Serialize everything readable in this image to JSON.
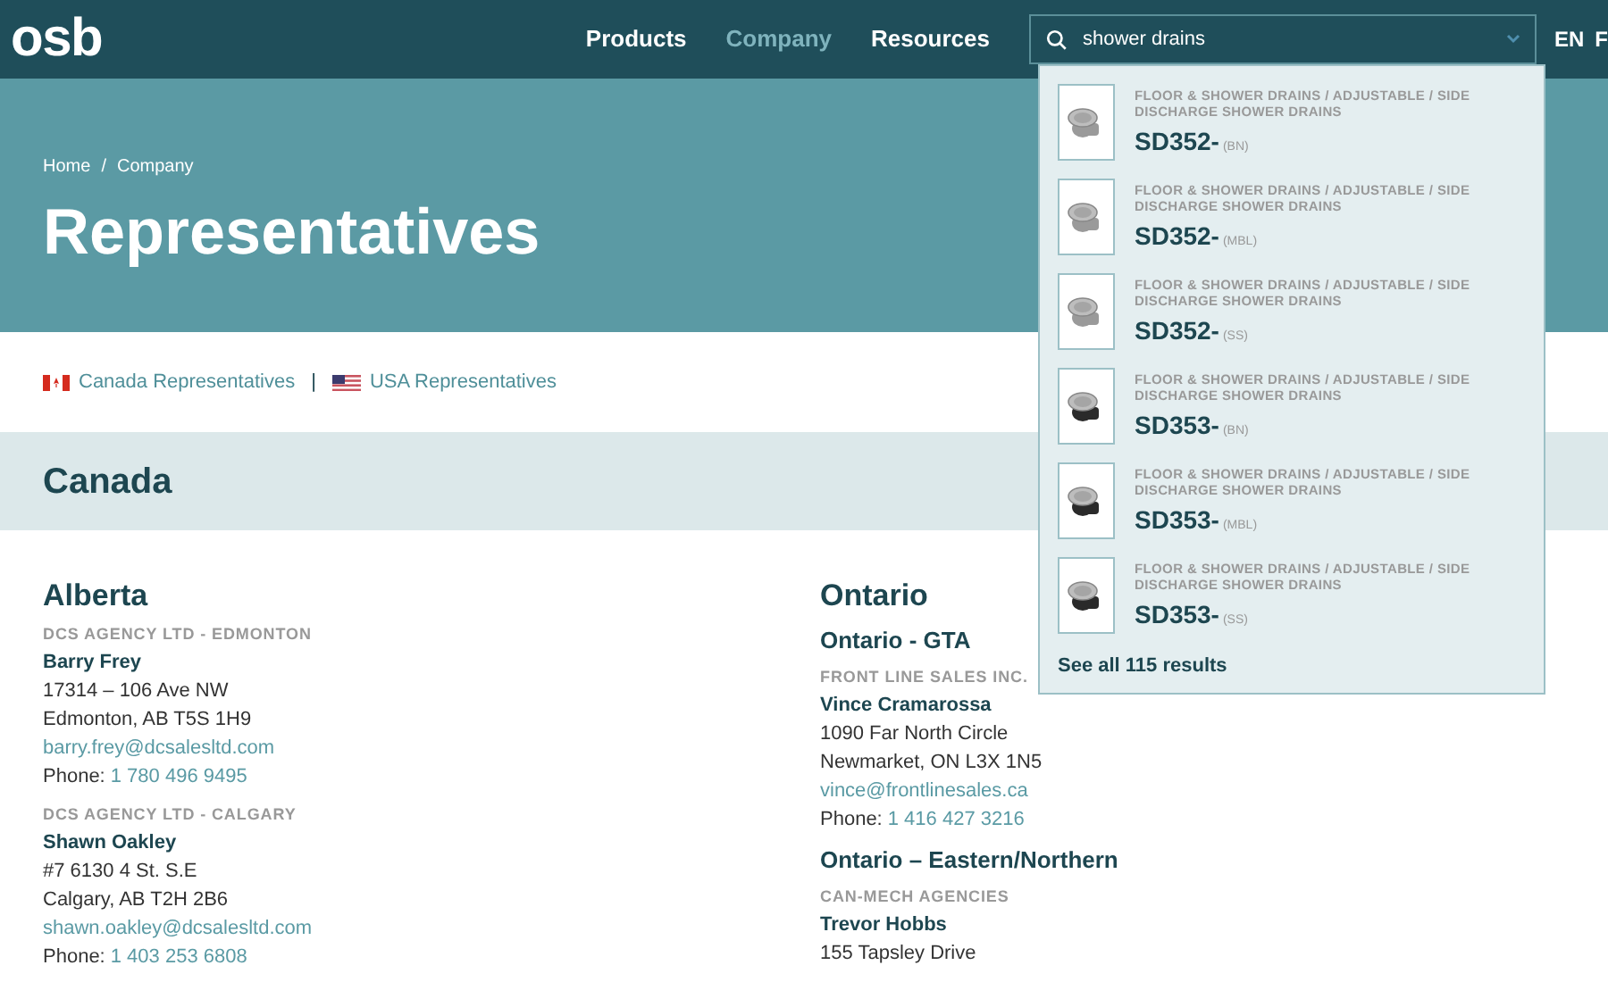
{
  "header": {
    "logo": "osb",
    "nav": [
      {
        "label": "Products",
        "selected": false
      },
      {
        "label": "Company",
        "selected": true
      },
      {
        "label": "Resources",
        "selected": false
      }
    ],
    "search": {
      "value": "shower drains"
    },
    "languages": [
      "EN",
      "F"
    ]
  },
  "search_results": {
    "items": [
      {
        "category": "FLOOR & SHOWER DRAINS / ADJUSTABLE / SIDE DISCHARGE SHOWER DRAINS",
        "code": "SD352-",
        "variant": "(BN)",
        "kind": "grey"
      },
      {
        "category": "FLOOR & SHOWER DRAINS / ADJUSTABLE / SIDE DISCHARGE SHOWER DRAINS",
        "code": "SD352-",
        "variant": "(MBL)",
        "kind": "grey"
      },
      {
        "category": "FLOOR & SHOWER DRAINS / ADJUSTABLE / SIDE DISCHARGE SHOWER DRAINS",
        "code": "SD352-",
        "variant": "(SS)",
        "kind": "grey"
      },
      {
        "category": "FLOOR & SHOWER DRAINS / ADJUSTABLE / SIDE DISCHARGE SHOWER DRAINS",
        "code": "SD353-",
        "variant": "(BN)",
        "kind": "black"
      },
      {
        "category": "FLOOR & SHOWER DRAINS / ADJUSTABLE / SIDE DISCHARGE SHOWER DRAINS",
        "code": "SD353-",
        "variant": "(MBL)",
        "kind": "black"
      },
      {
        "category": "FLOOR & SHOWER DRAINS / ADJUSTABLE / SIDE DISCHARGE SHOWER DRAINS",
        "code": "SD353-",
        "variant": "(SS)",
        "kind": "black"
      }
    ],
    "see_all": "See all 115 results"
  },
  "hero": {
    "breadcrumb": [
      "Home",
      "/",
      "Company"
    ],
    "title": "Representatives"
  },
  "country_links": [
    {
      "label": "Canada Representatives",
      "kind": "canada"
    },
    {
      "separator": "|"
    },
    {
      "label": "USA Representatives",
      "kind": "usa"
    }
  ],
  "section": {
    "title": "Canada"
  },
  "columns": [
    {
      "region": "Alberta",
      "groups": [
        {
          "agency": "DCS AGENCY LTD - EDMONTON",
          "name": "Barry Frey",
          "address": [
            "17314 – 106 Ave NW",
            "Edmonton, AB T5S 1H9"
          ],
          "email": "barry.frey@dcsalesltd.com",
          "phone_label": "Phone:",
          "phone": "1 780 496 9495"
        },
        {
          "agency": "DCS AGENCY LTD - CALGARY",
          "name": "Shawn Oakley",
          "address": [
            "#7 6130 4 St. S.E",
            "Calgary, AB T2H 2B6"
          ],
          "email": "shawn.oakley@dcsalesltd.com",
          "phone_label": "Phone:",
          "phone": "1 403 253 6808"
        }
      ]
    },
    {
      "region": "Ontario",
      "groups": [
        {
          "subregion": "Ontario - GTA",
          "agency": "FRONT LINE SALES INC.",
          "name": "Vince Cramarossa",
          "address": [
            "1090 Far North Circle",
            "Newmarket, ON L3X 1N5"
          ],
          "email": "vince@frontlinesales.ca",
          "phone_label": "Phone:",
          "phone": "1 416 427 3216"
        },
        {
          "subregion": "Ontario – Eastern/Northern",
          "agency": "CAN-MECH AGENCIES",
          "name": "Trevor Hobbs",
          "address": [
            "155 Tapsley Drive"
          ]
        }
      ]
    }
  ]
}
